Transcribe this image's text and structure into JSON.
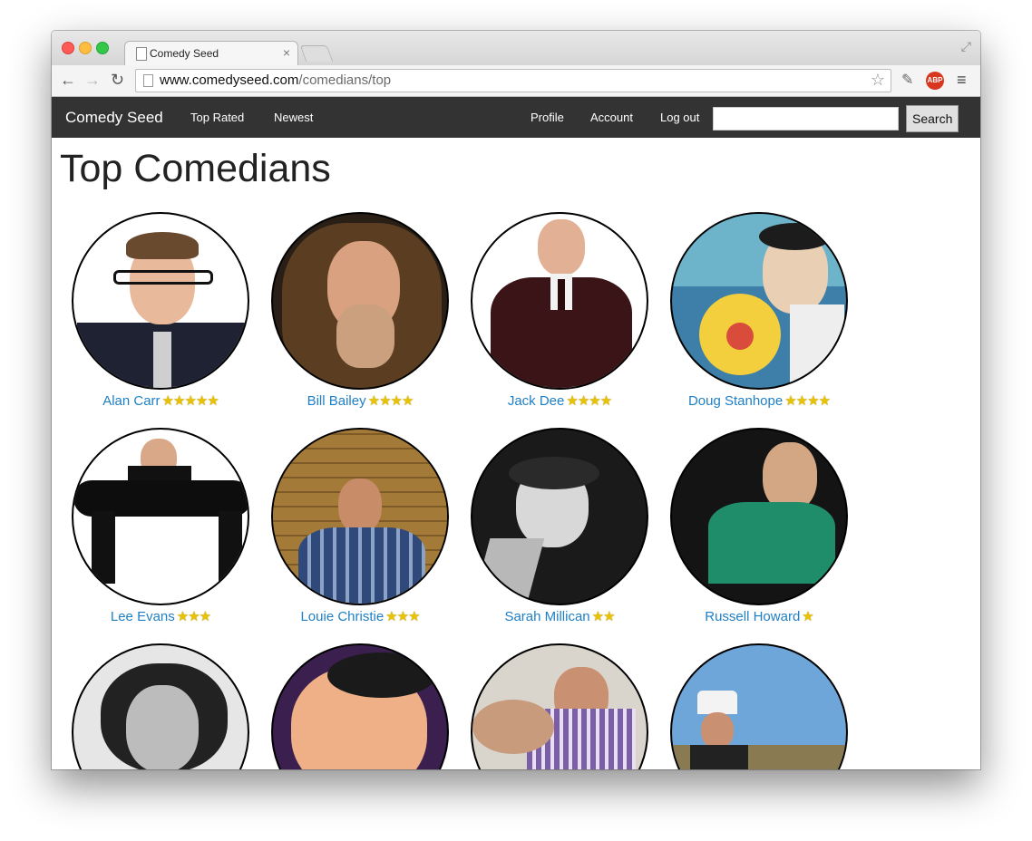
{
  "browser": {
    "tab_title": "Comedy Seed",
    "tab_close": "×",
    "url_host": "www.comedyseed.com",
    "url_path": "/comedians/top",
    "abp_label": "ABP"
  },
  "nav": {
    "brand": "Comedy Seed",
    "left_links": [
      "Top Rated",
      "Newest"
    ],
    "right_links": [
      "Profile",
      "Account",
      "Log out"
    ],
    "search_value": "",
    "search_button": "Search"
  },
  "page": {
    "title": "Top Comedians"
  },
  "comedians": [
    {
      "name": "Alan Carr",
      "stars": 5
    },
    {
      "name": "Bill Bailey",
      "stars": 4
    },
    {
      "name": "Jack Dee",
      "stars": 4
    },
    {
      "name": "Doug Stanhope",
      "stars": 4
    },
    {
      "name": "Lee Evans",
      "stars": 3
    },
    {
      "name": "Louie Christie",
      "stars": 3
    },
    {
      "name": "Sarah Millican",
      "stars": 2
    },
    {
      "name": "Russell Howard",
      "stars": 1
    },
    {
      "name": "",
      "stars": 0
    },
    {
      "name": "",
      "stars": 0
    },
    {
      "name": "",
      "stars": 0
    },
    {
      "name": "",
      "stars": 0
    }
  ],
  "colors": {
    "navbar": "#333333",
    "link": "#1f7fc5",
    "star": "#e9c200"
  }
}
